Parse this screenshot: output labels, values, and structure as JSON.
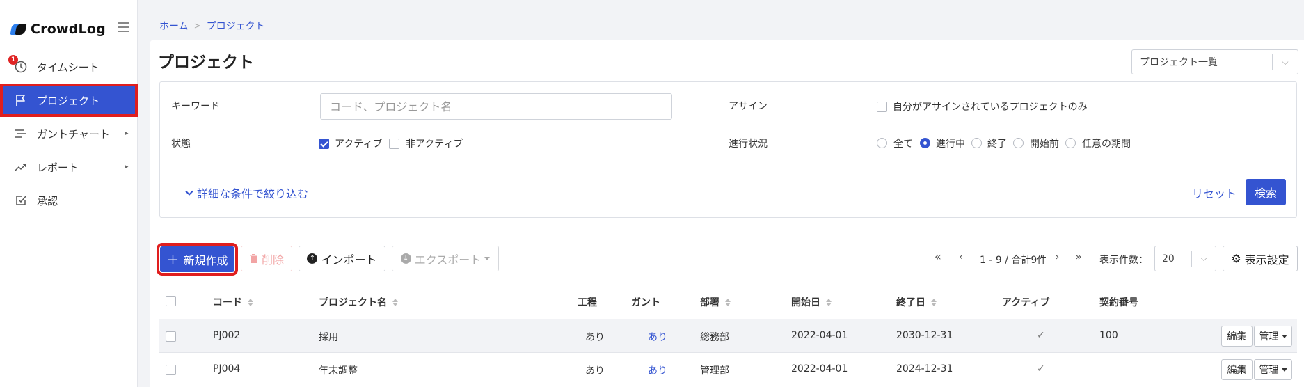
{
  "app": {
    "name": "CrowdLog",
    "badge_count": "1"
  },
  "sidebar": {
    "items": [
      {
        "label": "タイムシート",
        "icon": "clock-icon"
      },
      {
        "label": "プロジェクト",
        "icon": "flag-icon",
        "active": true
      },
      {
        "label": "ガントチャート",
        "icon": "gantt-icon"
      },
      {
        "label": "レポート",
        "icon": "trend-icon"
      },
      {
        "label": "承認",
        "icon": "check-square-icon"
      }
    ]
  },
  "breadcrumb": {
    "home": "ホーム",
    "separator": ">",
    "current": "プロジェクト"
  },
  "page": {
    "title": "プロジェクト",
    "view_select": "プロジェクト一覧"
  },
  "filters": {
    "keyword_label": "キーワード",
    "keyword_placeholder": "コード、プロジェクト名",
    "keyword_value": "",
    "assign_label": "アサイン",
    "assign_only": "自分がアサインされているプロジェクトのみ",
    "status_label": "状態",
    "status_active": "アクティブ",
    "status_inactive": "非アクティブ",
    "progress_label": "進行状況",
    "progress_options": [
      "全て",
      "進行中",
      "終了",
      "開始前",
      "任意の期間"
    ],
    "progress_selected": "進行中",
    "more_conditions": "詳細な条件で絞り込む",
    "reset": "リセット",
    "search": "検索"
  },
  "toolbar": {
    "new": "新規作成",
    "delete": "削除",
    "import": "インポート",
    "export": "エクスポート",
    "pagination": "1 - 9 / 合計9件",
    "per_page_label": "表示件数：",
    "per_page_value": "20",
    "display_settings": "表示設定"
  },
  "table": {
    "columns": [
      "コード",
      "プロジェクト名",
      "工程",
      "ガント",
      "部署",
      "開始日",
      "終了日",
      "アクティブ",
      "契約番号"
    ],
    "rows": [
      {
        "code": "PJ002",
        "name": "採用",
        "process": "あり",
        "gantt": "あり",
        "dept": "総務部",
        "start": "2022-04-01",
        "end": "2030-12-31",
        "active": "✓",
        "contract": "100",
        "edit": "編集",
        "manage": "管理"
      },
      {
        "code": "PJ004",
        "name": "年末調整",
        "process": "あり",
        "gantt": "あり",
        "dept": "管理部",
        "start": "2022-04-01",
        "end": "2024-12-31",
        "active": "✓",
        "contract": "",
        "edit": "編集",
        "manage": "管理"
      }
    ]
  },
  "colors": {
    "accent": "#3454d1",
    "highlight": "#e01e1e",
    "badge": "#e02424"
  }
}
